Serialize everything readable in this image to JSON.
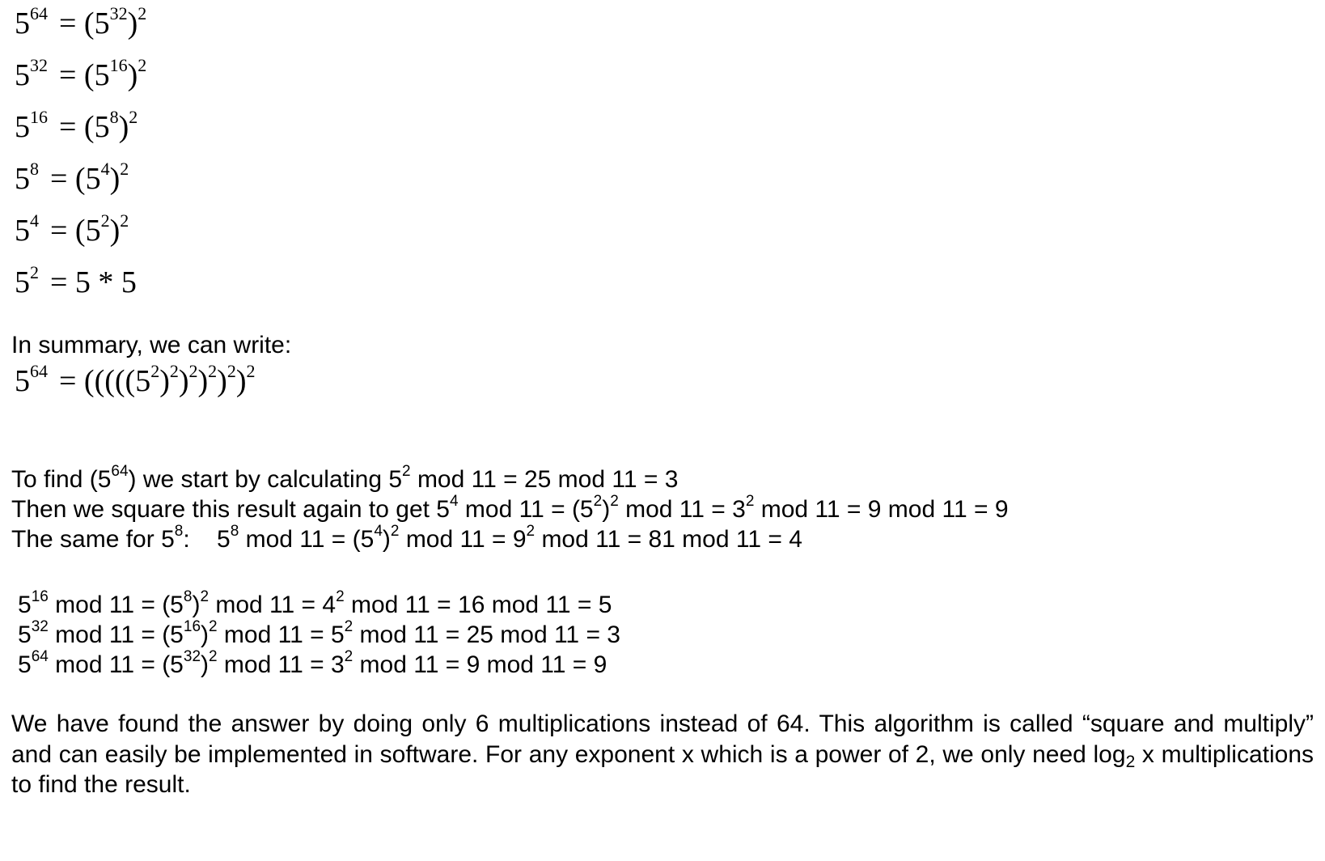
{
  "power_chain": {
    "rows": [
      {
        "base": "5",
        "exp": "64",
        "rhs_open": "= (5",
        "rhs_exp": "32",
        "rhs_close": ")",
        "outer_exp": "2"
      },
      {
        "base": "5",
        "exp": "32",
        "rhs_open": "= (5",
        "rhs_exp": "16",
        "rhs_close": ")",
        "outer_exp": "2"
      },
      {
        "base": "5",
        "exp": "16",
        "rhs_open": "= (5",
        "rhs_exp": "8",
        "rhs_close": ")",
        "outer_exp": "2"
      },
      {
        "base": "5",
        "exp": "8",
        "rhs_open": "= (5",
        "rhs_exp": "4",
        "rhs_close": ")",
        "outer_exp": "2"
      },
      {
        "base": "5",
        "exp": "4",
        "rhs_open": "= (5",
        "rhs_exp": "2",
        "rhs_close": ")",
        "outer_exp": "2"
      }
    ],
    "last_row": {
      "base": "5",
      "exp": "2",
      "rhs": "= 5 * 5"
    }
  },
  "summary": {
    "intro": "In summary, we can write:",
    "base": "5",
    "exp": "64",
    "eq_open": "= (((((5",
    "sq": "2",
    "close": ")"
  },
  "calc": {
    "line1": {
      "a": "To find (5",
      "a_exp": "64",
      "b": ") we start by calculating  5",
      "b_exp": "2",
      "c": " mod 11 = 25 mod 11 = 3"
    },
    "line2": {
      "a": "Then we square this result again to get 5",
      "a_exp": "4",
      "b": " mod 11 = (5",
      "b_exp": "2",
      "c": ")",
      "c_exp": "2",
      "d": " mod 11 = 3",
      "d_exp": "2",
      "e": " mod 11 = 9 mod 11 = 9"
    },
    "line3": {
      "a": "The same for 5",
      "a_exp": "8",
      "b": ":    5",
      "b_exp": "8",
      "c": " mod 11 = (5",
      "c_exp": "4",
      "d": ")",
      "d_exp": "2",
      "e": " mod 11 = 9",
      "e_exp": "2",
      "f": " mod 11 = 81 mod 11 = 4"
    }
  },
  "mods": [
    {
      "a": "5",
      "a_exp": "16",
      "b": " mod 11 = (5",
      "b_exp": "8",
      "c": ")",
      "c_exp": "2",
      "d": " mod 11 = 4",
      "d_exp": "2",
      "e": " mod 11 = 16 mod 11 = 5"
    },
    {
      "a": "5",
      "a_exp": "32",
      "b": " mod 11 = (5",
      "b_exp": "16",
      "c": ")",
      "c_exp": "2",
      "d": " mod 11 = 5",
      "d_exp": "2",
      "e": " mod 11 = 25 mod 11 = 3"
    },
    {
      "a": "5",
      "a_exp": "64",
      "b": " mod 11 = (5",
      "b_exp": "32",
      "c": ")",
      "c_exp": "2",
      "d": " mod 11 = 3",
      "d_exp": "2",
      "e": " mod 11 = 9 mod 11 = 9"
    }
  ],
  "conclusion": {
    "main": "We have found the answer by doing only 6 multiplications instead of 64. This algorithm is called “square and multiply” and can easily be implemented in software. For any exponent x which is a power of 2, we only need log",
    "sub": "2",
    "tail": " x multiplications to find the result."
  }
}
